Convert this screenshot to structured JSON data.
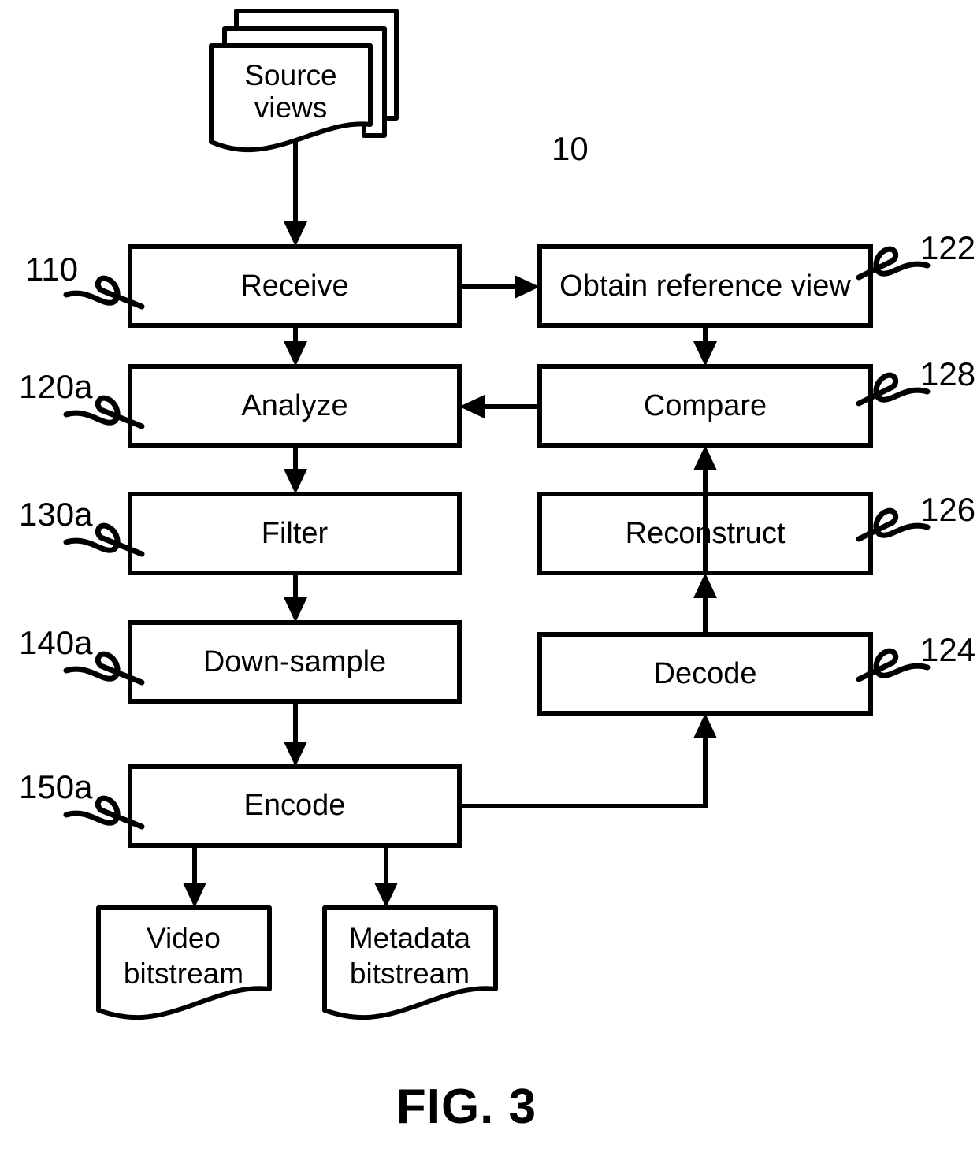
{
  "figure": {
    "caption": "FIG. 3",
    "system_label": "10"
  },
  "sources": [
    {
      "id": "source-views",
      "line1": "Source",
      "line2": "views"
    }
  ],
  "left_column": [
    {
      "id": "receive",
      "label": "Receive",
      "ref": "110"
    },
    {
      "id": "analyze",
      "label": "Analyze",
      "ref": "120a"
    },
    {
      "id": "filter",
      "label": "Filter",
      "ref": "130a"
    },
    {
      "id": "downsample",
      "label": "Down-sample",
      "ref": "140a"
    },
    {
      "id": "encode",
      "label": "Encode",
      "ref": "150a"
    }
  ],
  "right_column": [
    {
      "id": "obtain-reference-view",
      "label": "Obtain reference view",
      "ref": "122"
    },
    {
      "id": "compare",
      "label": "Compare",
      "ref": "128"
    },
    {
      "id": "reconstruct",
      "label": "Reconstruct",
      "ref": "126"
    },
    {
      "id": "decode",
      "label": "Decode",
      "ref": "124"
    }
  ],
  "outputs": [
    {
      "id": "video-bitstream",
      "line1": "Video",
      "line2": "bitstream"
    },
    {
      "id": "metadata-bitstream",
      "line1": "Metadata",
      "line2": "bitstream"
    }
  ],
  "style": {
    "stroke_color": "#000000",
    "fill_color": "#ffffff",
    "background": "#ffffff"
  }
}
